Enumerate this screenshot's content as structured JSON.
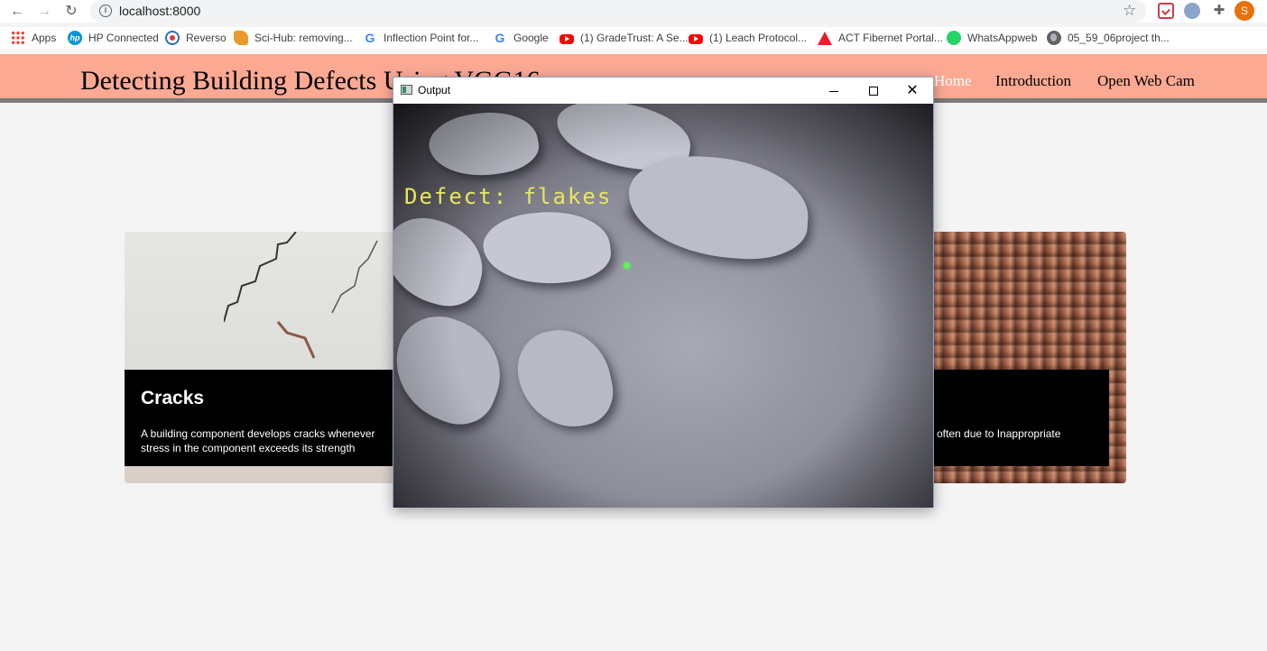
{
  "browser": {
    "url": "localhost:8000",
    "profile_initial": "S",
    "bookmarks": [
      {
        "label": "Apps",
        "icon": "apps-grid-icon"
      },
      {
        "label": "HP Connected",
        "icon": "hp-icon"
      },
      {
        "label": "Reverso",
        "icon": "reverso-icon"
      },
      {
        "label": "Sci-Hub: removing...",
        "icon": "scihub-icon"
      },
      {
        "label": "Inflection Point for...",
        "icon": "google-icon"
      },
      {
        "label": "Google",
        "icon": "google-icon"
      },
      {
        "label": "(1) GradeTrust: A Se...",
        "icon": "youtube-icon"
      },
      {
        "label": "(1) Leach Protocol...",
        "icon": "youtube-icon"
      },
      {
        "label": "ACT Fibernet Portal...",
        "icon": "act-icon"
      },
      {
        "label": "WhatsAppweb",
        "icon": "whatsapp-icon"
      },
      {
        "label": "05_59_06project th...",
        "icon": "globe-icon"
      }
    ]
  },
  "site": {
    "title": "Detecting Building Defects Using VGG16",
    "nav": {
      "home": "Home",
      "introduction": "Introduction",
      "webcam": "Open Web Cam"
    },
    "cards": [
      {
        "title": "Cracks",
        "description": "A building component develops cracks whenever stress in the component exceeds its strength"
      },
      {
        "description_visible": "often due to Inappropriate"
      }
    ]
  },
  "output_window": {
    "title": "Output",
    "prediction": "Defect: flakes"
  }
}
